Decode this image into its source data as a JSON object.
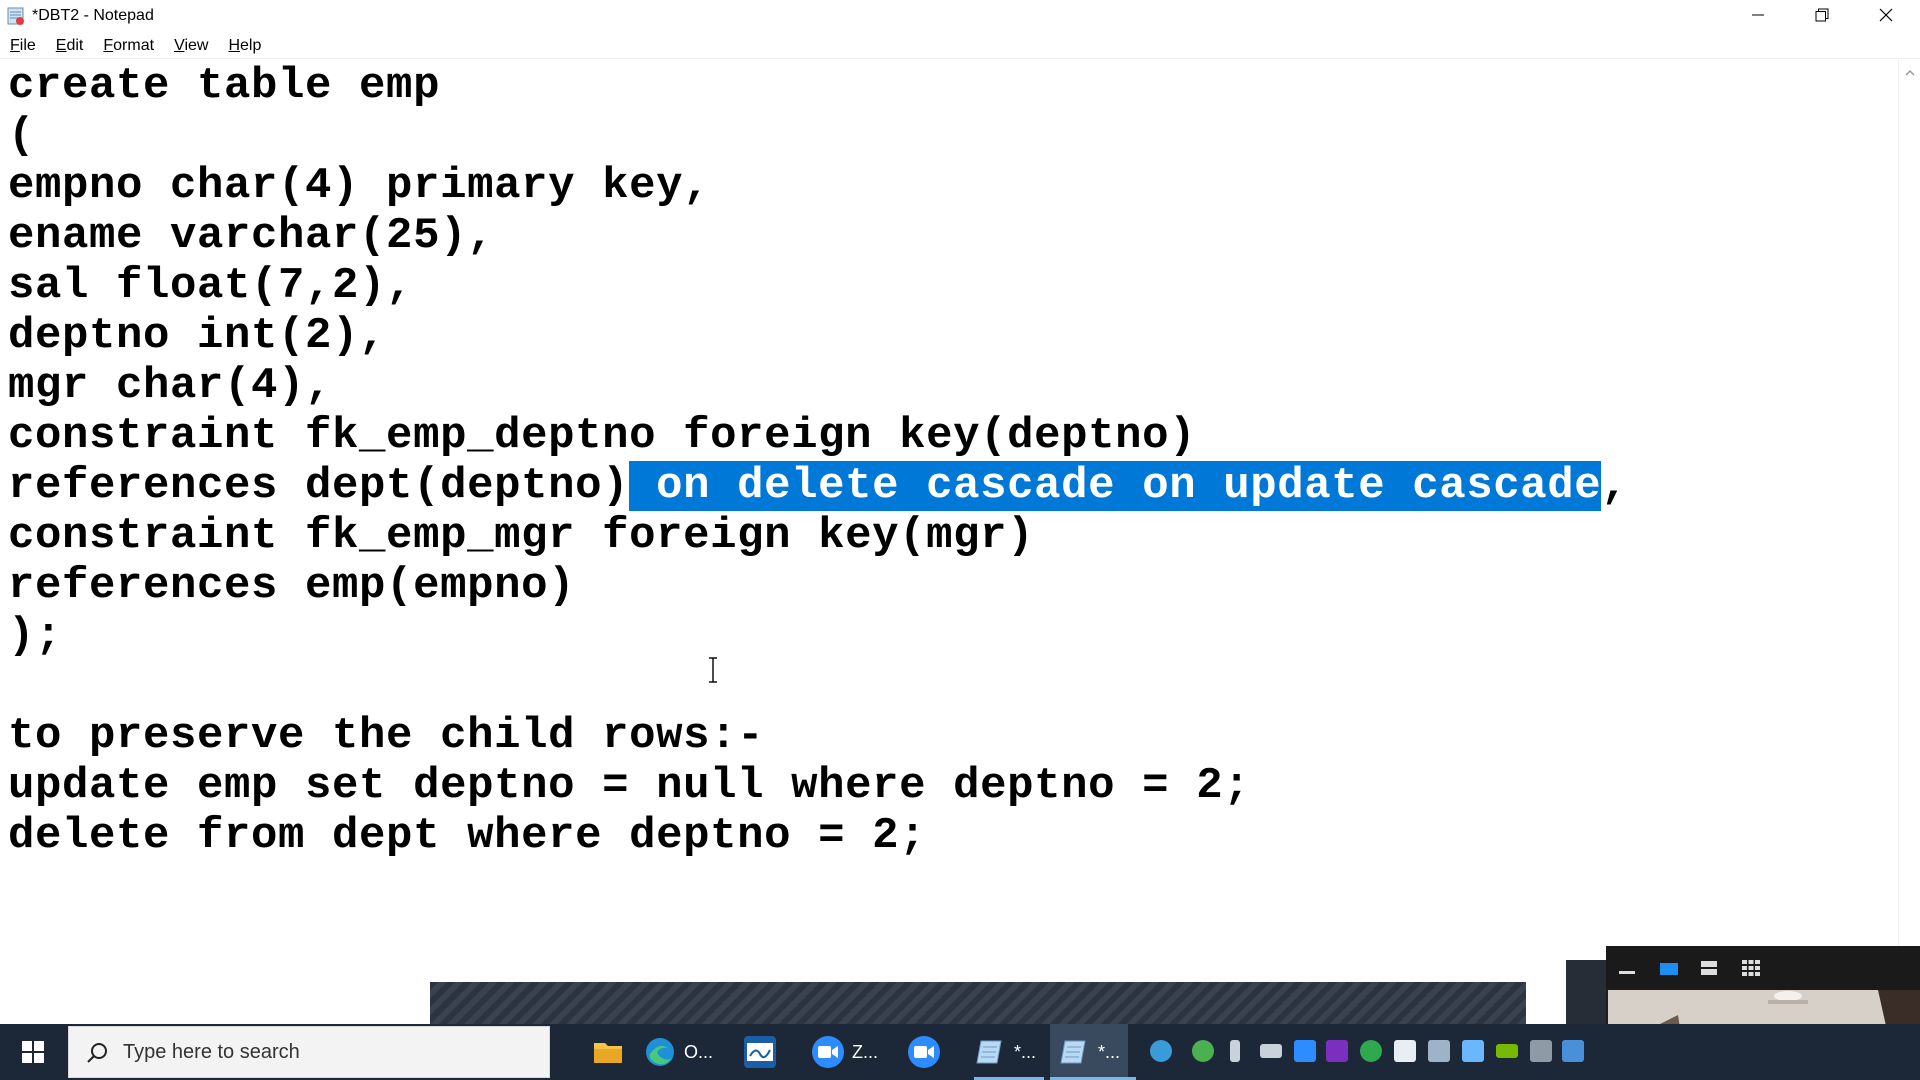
{
  "window": {
    "title": "*DBT2 - Notepad"
  },
  "menu": {
    "items": [
      {
        "label": "File"
      },
      {
        "label": "Edit"
      },
      {
        "label": "Format"
      },
      {
        "label": "View"
      },
      {
        "label": "Help"
      }
    ]
  },
  "editor": {
    "lines": [
      {
        "text": "create table emp"
      },
      {
        "text": "("
      },
      {
        "text": "empno char(4) primary key,"
      },
      {
        "text": "ename varchar(25),"
      },
      {
        "text": "sal float(7,2),"
      },
      {
        "text": "deptno int(2),"
      },
      {
        "text": "mgr char(4),"
      },
      {
        "text": "constraint fk_emp_deptno foreign key(deptno)"
      },
      {
        "pre": "references dept(deptno)",
        "selected": " on delete cascade on update cascade",
        "post": ","
      },
      {
        "text": "constraint fk_emp_mgr foreign key(mgr)"
      },
      {
        "text": "references emp(empno)"
      },
      {
        "text": ");"
      },
      {
        "text": ""
      },
      {
        "text": "to preserve the child rows:-"
      },
      {
        "text": "update emp set deptno = null where deptno = 2;"
      },
      {
        "text": "delete from dept where deptno = 2;"
      }
    ]
  },
  "taskbar": {
    "search_placeholder": "Type here to search",
    "apps": [
      {
        "icon": "file-explorer-icon",
        "label": ""
      },
      {
        "icon": "edge-icon",
        "label": "O..."
      },
      {
        "icon": "whiteboard-icon",
        "label": ""
      },
      {
        "icon": "zoom-icon",
        "label": "Z..."
      },
      {
        "icon": "zoom-meeting-icon",
        "label": ""
      },
      {
        "icon": "notepad-icon",
        "label": "*..."
      },
      {
        "icon": "notepad-icon",
        "label": "*..."
      }
    ]
  },
  "colors": {
    "selection": "#0078d7",
    "taskbar": "#1c2838",
    "accent": "#76b9ed"
  }
}
